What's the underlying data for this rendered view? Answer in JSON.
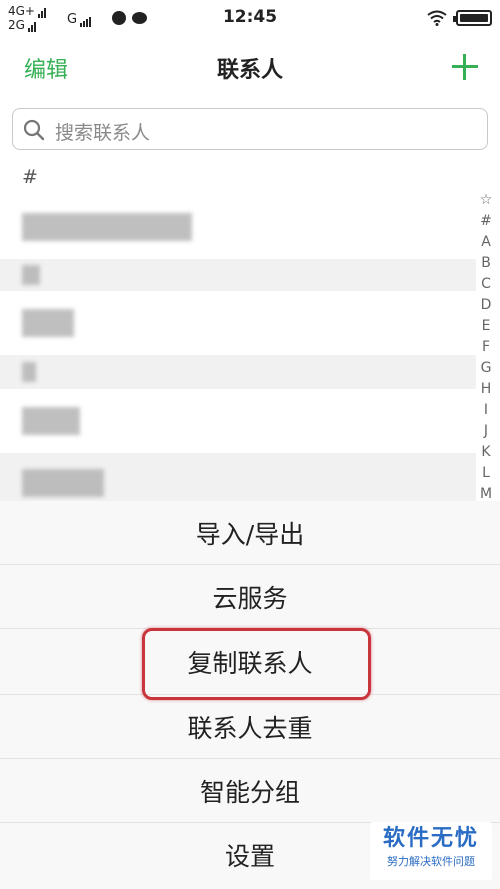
{
  "status_bar": {
    "network_top": "4G+",
    "network_bottom": "2G",
    "network_third": "G",
    "time": "12:45"
  },
  "header": {
    "edit_label": "编辑",
    "title": "联系人"
  },
  "search": {
    "placeholder": "搜索联系人"
  },
  "contacts": {
    "section": "#",
    "items_blurred": 6
  },
  "index_bar": [
    "☆",
    "#",
    "A",
    "B",
    "C",
    "D",
    "E",
    "F",
    "G",
    "H",
    "I",
    "J",
    "K",
    "L",
    "M"
  ],
  "action_sheet": {
    "items": [
      {
        "label": "导入/导出"
      },
      {
        "label": "云服务"
      },
      {
        "label": "复制联系人",
        "highlighted": true
      },
      {
        "label": "联系人去重"
      },
      {
        "label": "智能分组"
      },
      {
        "label": "设置"
      }
    ]
  },
  "watermark": {
    "title": "软件无忧",
    "subtitle": "努力解决软件问题"
  },
  "colors": {
    "accent_green": "#35b054",
    "highlight_red": "#c9343d",
    "watermark_blue": "#2a6cc4"
  }
}
